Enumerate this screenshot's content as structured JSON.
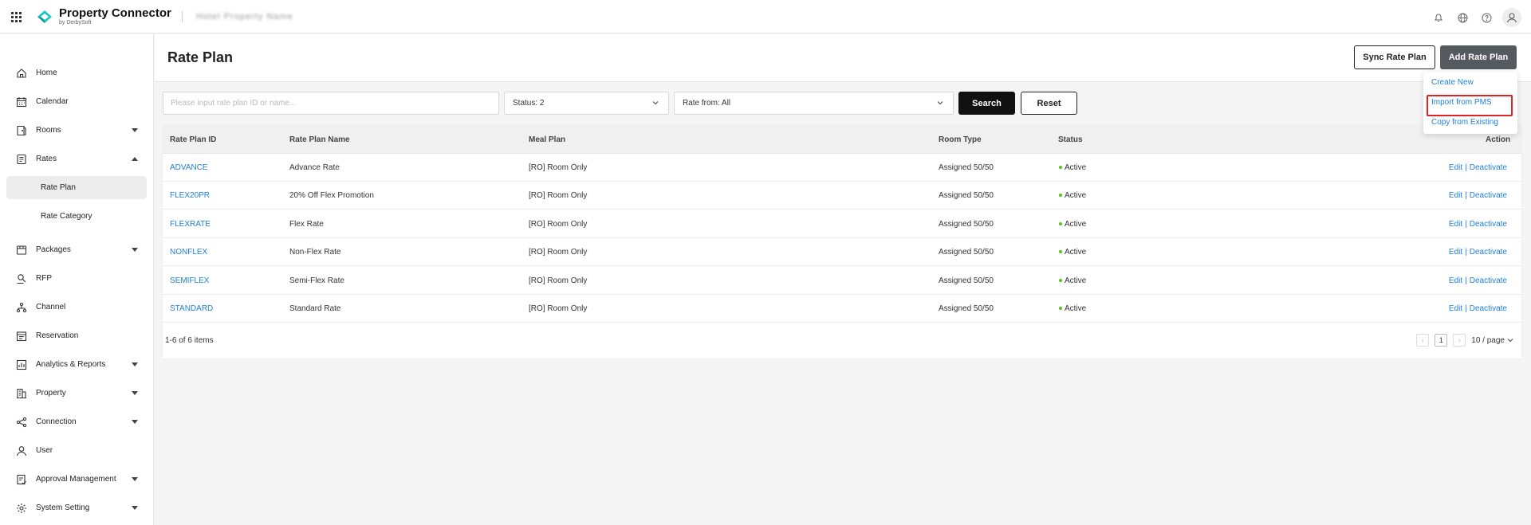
{
  "app": {
    "brand_name": "Property Connector",
    "brand_sub": "by DerbySoft",
    "hotel_name": "Hotel Property Name",
    "accent_color": "#1fc7c1"
  },
  "topbar": {
    "icons": [
      "notification-icon",
      "globe-icon",
      "help-icon",
      "user-icon"
    ]
  },
  "sidebar": {
    "items": [
      {
        "label": "Home",
        "icon": "home-icon"
      },
      {
        "label": "Calendar",
        "icon": "calendar-icon"
      },
      {
        "label": "Rooms",
        "icon": "rooms-icon"
      },
      {
        "label": "Rates",
        "icon": "rates-icon"
      },
      {
        "label": "Packages",
        "icon": "packages-icon"
      },
      {
        "label": "RFP",
        "icon": "rfp-icon"
      },
      {
        "label": "Channel",
        "icon": "channel-icon"
      },
      {
        "label": "Reservation",
        "icon": "reservation-icon"
      },
      {
        "label": "Analytics & Reports",
        "icon": "analytics-icon"
      },
      {
        "label": "Property",
        "icon": "property-icon"
      },
      {
        "label": "Connection",
        "icon": "connection-icon"
      },
      {
        "label": "User",
        "icon": "user-icon"
      },
      {
        "label": "Approval Management",
        "icon": "approval-icon"
      },
      {
        "label": "System Setting",
        "icon": "settings-icon"
      }
    ],
    "rates_sub": [
      {
        "label": "Rate Plan",
        "active": true
      },
      {
        "label": "Rate Category",
        "active": false
      }
    ]
  },
  "header": {
    "title": "Rate Plan",
    "sync_label": "Sync Rate Plan",
    "add_label": "Add Rate Plan"
  },
  "filters": {
    "search_placeholder": "Please input rate plan ID or name...",
    "status_value": "Status: 2",
    "rate_from_value": "Rate from: All",
    "search_label": "Search",
    "reset_label": "Reset"
  },
  "dropdown": {
    "items": [
      "Create New",
      "Import from PMS",
      "Copy from Existing"
    ]
  },
  "table": {
    "columns": [
      "Rate Plan ID",
      "Rate Plan Name",
      "Meal Plan",
      "Room Type",
      "Status",
      "Action"
    ],
    "rows": [
      {
        "id": "ADVANCE",
        "name": "Advance Rate",
        "meal": "[RO] Room Only",
        "room": "Assigned 50/50",
        "status": "Active",
        "edit": "Edit",
        "sep": "|",
        "deactivate": "Deactivate"
      },
      {
        "id": "FLEX20PR",
        "name": "20% Off Flex Promotion",
        "meal": "[RO] Room Only",
        "room": "Assigned 50/50",
        "status": "Active",
        "edit": "Edit",
        "sep": "|",
        "deactivate": "Deactivate"
      },
      {
        "id": "FLEXRATE",
        "name": "Flex Rate",
        "meal": "[RO] Room Only",
        "room": "Assigned 50/50",
        "status": "Active",
        "edit": "Edit",
        "sep": "|",
        "deactivate": "Deactivate"
      },
      {
        "id": "NONFLEX",
        "name": "Non-Flex Rate",
        "meal": "[RO] Room Only",
        "room": "Assigned 50/50",
        "status": "Active",
        "edit": "Edit",
        "sep": "|",
        "deactivate": "Deactivate"
      },
      {
        "id": "SEMIFLEX",
        "name": "Semi-Flex Rate",
        "meal": "[RO] Room Only",
        "room": "Assigned 50/50",
        "status": "Active",
        "edit": "Edit",
        "sep": "|",
        "deactivate": "Deactivate"
      },
      {
        "id": "STANDARD",
        "name": "Standard Rate",
        "meal": "[RO] Room Only",
        "room": "Assigned 50/50",
        "status": "Active",
        "edit": "Edit",
        "sep": "|",
        "deactivate": "Deactivate"
      }
    ],
    "footer_count": "1-6 of 6 items",
    "page": "1",
    "page_size": "10 / page"
  }
}
